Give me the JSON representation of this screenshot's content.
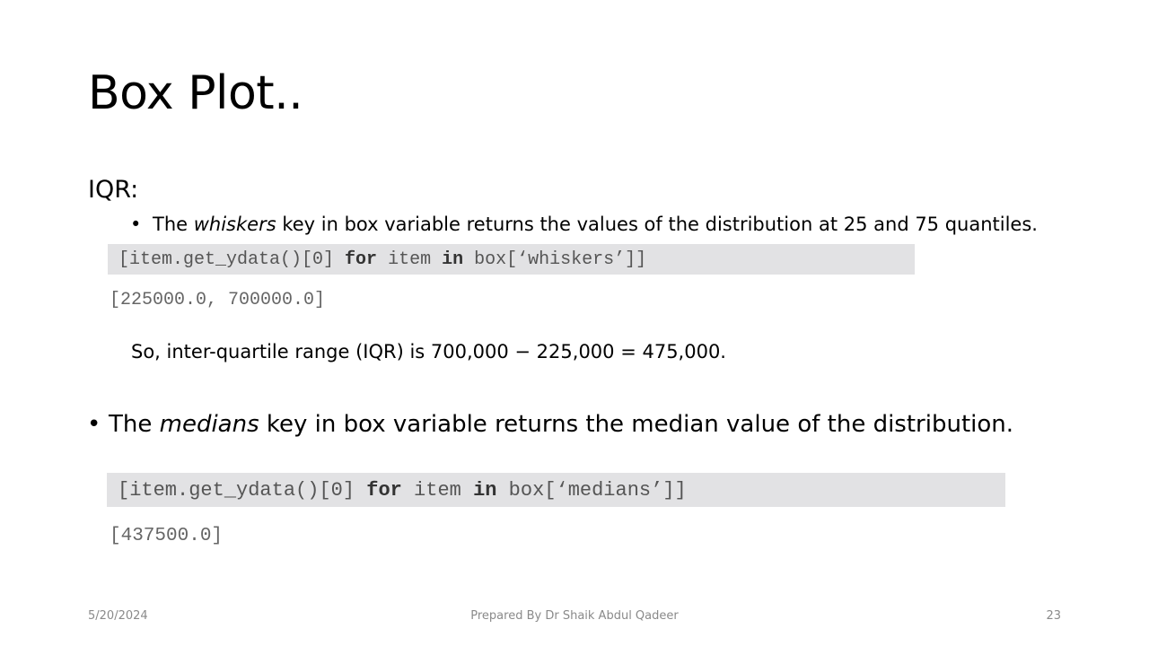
{
  "slide": {
    "title": "Box Plot..",
    "heading": "IQR:",
    "bullet1": {
      "marker": "•",
      "pre": "The ",
      "emph": "whiskers",
      "post": " key in box variable returns the values of the distribution at 25 and 75 quantiles."
    },
    "code1": {
      "part1": "[item.get_ydata()[0] ",
      "kw1": "for",
      "part2": " item ",
      "kw2": "in",
      "part3": " box[‘whiskers’]]"
    },
    "output1": "[225000.0, 700000.0]",
    "iqr_text": "So, inter-quartile range (IQR) is 700,000 − 225,000 = 475,000.",
    "bullet2": {
      "marker": "•",
      "pre": "The ",
      "emph": "medians",
      "post": " key in box variable returns the median value of the distribution."
    },
    "code2": {
      "part1": "[item.get_ydata()[0] ",
      "kw1": "for",
      "part2": " item ",
      "kw2": "in",
      "part3": " box[‘medians’]]"
    },
    "output2": "[437500.0]"
  },
  "footer": {
    "date": "5/20/2024",
    "author": "Prepared By Dr Shaik Abdul Qadeer",
    "page_number": "23"
  }
}
